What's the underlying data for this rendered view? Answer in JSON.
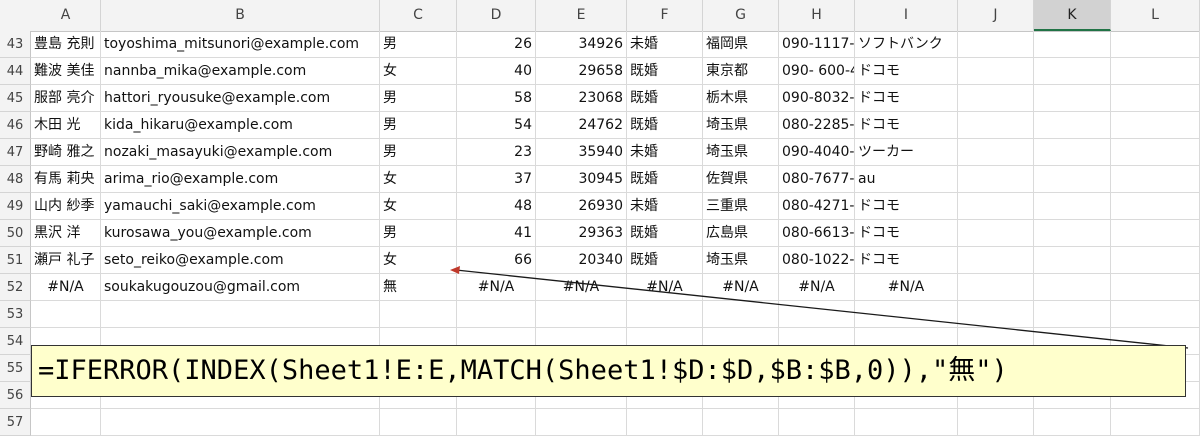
{
  "columns": [
    "A",
    "B",
    "C",
    "D",
    "E",
    "F",
    "G",
    "H",
    "I",
    "J",
    "K",
    "L"
  ],
  "rows": [
    {
      "num": "43",
      "a": "豊島 充則",
      "b": "toyoshima_mitsunori@example.com",
      "c": "男",
      "d": "26",
      "e": "34926",
      "f": "未婚",
      "g": "福岡県",
      "h": "090-1117-",
      "i": "ソフトバンク"
    },
    {
      "num": "44",
      "a": "難波 美佳",
      "b": "nannba_mika@example.com",
      "c": "女",
      "d": "40",
      "e": "29658",
      "f": "既婚",
      "g": "東京都",
      "h": "090- 600-4",
      "i": "ドコモ"
    },
    {
      "num": "45",
      "a": "服部 亮介",
      "b": "hattori_ryousuke@example.com",
      "c": "男",
      "d": "58",
      "e": "23068",
      "f": "既婚",
      "g": "栃木県",
      "h": "090-8032-",
      "i": "ドコモ"
    },
    {
      "num": "46",
      "a": "木田 光",
      "b": "kida_hikaru@example.com",
      "c": "男",
      "d": "54",
      "e": "24762",
      "f": "既婚",
      "g": "埼玉県",
      "h": "080-2285-",
      "i": "ドコモ"
    },
    {
      "num": "47",
      "a": "野崎 雅之",
      "b": "nozaki_masayuki@example.com",
      "c": "男",
      "d": "23",
      "e": "35940",
      "f": "未婚",
      "g": "埼玉県",
      "h": "090-4040-",
      "i": "ツーカー"
    },
    {
      "num": "48",
      "a": "有馬 莉央",
      "b": "arima_rio@example.com",
      "c": "女",
      "d": "37",
      "e": "30945",
      "f": "既婚",
      "g": "佐賀県",
      "h": "080-7677-",
      "i": "au"
    },
    {
      "num": "49",
      "a": "山内 紗季",
      "b": "yamauchi_saki@example.com",
      "c": "女",
      "d": "48",
      "e": "26930",
      "f": "未婚",
      "g": "三重県",
      "h": "080-4271-",
      "i": "ドコモ"
    },
    {
      "num": "50",
      "a": "黒沢 洋",
      "b": "kurosawa_you@example.com",
      "c": "男",
      "d": "41",
      "e": "29363",
      "f": "既婚",
      "g": "広島県",
      "h": "080-6613-",
      "i": "ドコモ"
    },
    {
      "num": "51",
      "a": "瀬戸 礼子",
      "b": "seto_reiko@example.com",
      "c": "女",
      "d": "66",
      "e": "20340",
      "f": "既婚",
      "g": "埼玉県",
      "h": "080-1022-",
      "i": "ドコモ"
    },
    {
      "num": "52",
      "a": "#N/A",
      "b": "soukakugouzou@gmail.com",
      "c": "無",
      "d": "#N/A",
      "e": "#N/A",
      "f": "#N/A",
      "g": "#N/A",
      "h": "#N/A",
      "i": "#N/A"
    },
    {
      "num": "53"
    },
    {
      "num": "54"
    },
    {
      "num": "55"
    },
    {
      "num": "56"
    },
    {
      "num": "57"
    }
  ],
  "formula_callout": "=IFERROR(INDEX(Sheet1!E:E,MATCH(Sheet1!$D:$D,$B:$B,0)),\"無\")",
  "colors": {
    "callout_bg": "#ffffcc",
    "arrow": "#1a1a1a",
    "arrow_head": "#c0392b",
    "selected_header_border": "#217346"
  }
}
